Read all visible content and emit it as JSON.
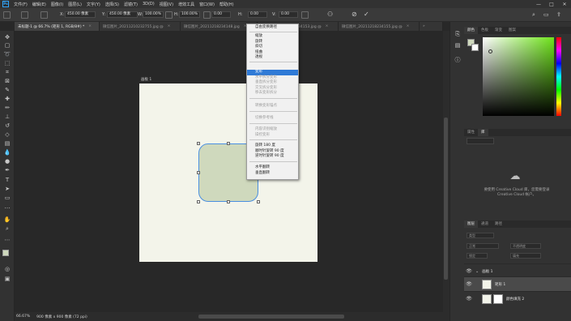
{
  "menubar": {
    "items": [
      "文件(F)",
      "编辑(E)",
      "图像(I)",
      "图层(L)",
      "文字(Y)",
      "选择(S)",
      "滤镜(T)",
      "3D(D)",
      "视图(V)",
      "增效工具",
      "窗口(W)",
      "帮助(H)"
    ]
  },
  "options": {
    "x_label": "X:",
    "x_value": "450.00 像素",
    "y_label": "Y:",
    "y_value": "450.00 像素",
    "w_label": "W:",
    "w_value": "100.00%",
    "h_label": "H:",
    "h_value": "100.00%",
    "angle_value": "0.00",
    "hskew_label": "H:",
    "hskew_value": "0.00",
    "vskew_label": "V:",
    "vskew_value": "0.00"
  },
  "tabs": [
    {
      "label": "未标题-1 @ 66.7% (矩形 1, RGB/8#) *",
      "active": true
    },
    {
      "label": "微信图片_20211210232755.jpg @",
      "active": false
    },
    {
      "label": "微信图片_20211218234148.jpg",
      "active": false
    },
    {
      "label": "微信图片_20211218234153.jpg @",
      "active": false
    },
    {
      "label": "微信图片_20211218234155.jpg @",
      "active": false
    }
  ],
  "canvas": {
    "artboard_label": "画板 1",
    "shape_color": "#cfd9bd",
    "canvas_color": "#f3f4ea",
    "selection_color": "#4a8fe0"
  },
  "context_menu": {
    "items": [
      {
        "label": "自由变换路径",
        "state": "normal"
      },
      {
        "label": "缩放",
        "state": "normal"
      },
      {
        "label": "旋转",
        "state": "normal"
      },
      {
        "label": "斜切",
        "state": "normal"
      },
      {
        "label": "扭曲",
        "state": "normal"
      },
      {
        "label": "透视",
        "state": "normal"
      },
      {
        "label": "变形",
        "state": "highlight"
      },
      {
        "label": "水平拆分变形",
        "state": "disabled"
      },
      {
        "label": "垂直拆分变形",
        "state": "disabled"
      },
      {
        "label": "交叉拆分变形",
        "state": "disabled"
      },
      {
        "label": "移去变形拆分",
        "state": "disabled"
      },
      {
        "label": "转换变形锚点",
        "state": "disabled"
      },
      {
        "label": "切换参考线",
        "state": "disabled"
      },
      {
        "label": "内容识别缩放",
        "state": "disabled"
      },
      {
        "label": "操控变形",
        "state": "disabled"
      },
      {
        "label": "旋转 180 度",
        "state": "normal"
      },
      {
        "label": "顺时针旋转 90 度",
        "state": "normal"
      },
      {
        "label": "逆时针旋转 90 度",
        "state": "normal"
      },
      {
        "label": "水平翻转",
        "state": "normal"
      },
      {
        "label": "垂直翻转",
        "state": "normal"
      }
    ]
  },
  "panels": {
    "color_tabs": [
      "颜色",
      "色板",
      "渐变",
      "图案"
    ],
    "fg_color": "#cfd9bd",
    "bg_color": "#ffffff",
    "libraries_tabs": [
      "属性",
      "库"
    ],
    "cc_message": "要使用 Creative Cloud 库，您需要登录 Creative Cloud 帐户。",
    "layers_tabs": [
      "图层",
      "通道",
      "路径"
    ],
    "kind_field": "类型",
    "blend_mode": "正常",
    "opacity": "不透明度",
    "lock": "锁定",
    "fill": "填充",
    "layers": [
      {
        "name": "画板 1",
        "type": "group"
      },
      {
        "name": "矩形 1",
        "type": "layer",
        "selected": true
      },
      {
        "name": "颜色填充 2",
        "type": "fill"
      }
    ]
  },
  "status": {
    "zoom": "66.67%",
    "info": "900 像素 x 900 像素 (72 ppi)"
  }
}
